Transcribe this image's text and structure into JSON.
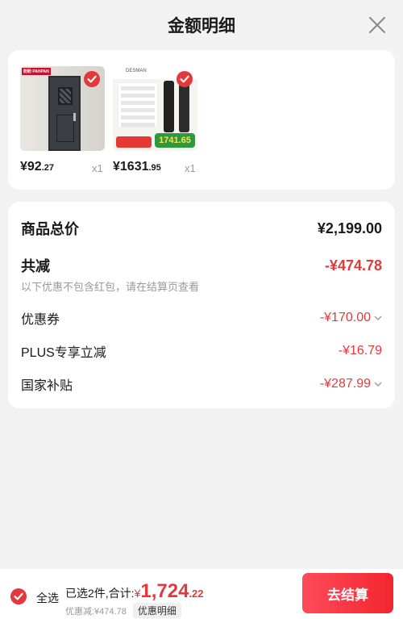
{
  "header": {
    "title": "金额明细"
  },
  "products": [
    {
      "price_int": "¥92",
      "price_dec": ".27",
      "qty": "x1",
      "brand_tag": "盼盼 PANPAN"
    },
    {
      "price_int": "¥1631",
      "price_dec": ".95",
      "qty": "x1",
      "brand_tag": "DESMAN",
      "badge_price": "1741.65"
    }
  ],
  "summary": {
    "total_label": "商品总价",
    "total_value": "¥2,199.00",
    "reduce_label": "共减",
    "reduce_value": "-¥474.78",
    "note": "以下优惠不包含红包，请在结算页查看",
    "items": [
      {
        "label": "优惠券",
        "value": "-¥170.00"
      },
      {
        "label": "PLUS专享立减",
        "value": "-¥16.79"
      },
      {
        "label": "国家补贴",
        "value": "-¥287.99"
      }
    ]
  },
  "bottom": {
    "select_all": "全选",
    "selected_text": "已选2件,合计:",
    "currency": "¥",
    "total_int": "1,724",
    "total_dec": ".22",
    "discount_text": "优惠减:¥474.78",
    "detail_button": "优惠明细",
    "checkout_button": "去结算"
  },
  "colors": {
    "accent": "#e4393c",
    "background": "#f2f2f2"
  }
}
